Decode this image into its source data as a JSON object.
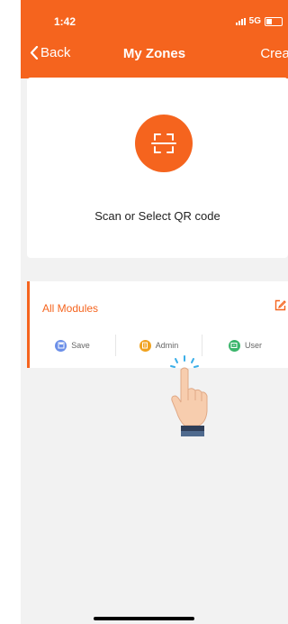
{
  "status_bar": {
    "time": "1:42",
    "network": "5G"
  },
  "nav": {
    "back_label": "Back",
    "title": "My Zones",
    "create_label": "Creat"
  },
  "scan": {
    "label": "Scan or Select QR code"
  },
  "modules": {
    "title": "All Modules",
    "actions": [
      {
        "label": "Save",
        "icon": "save-icon",
        "color": "#6b8fe8"
      },
      {
        "label": "Admin",
        "icon": "admin-icon",
        "color": "#f0a21e"
      },
      {
        "label": "User",
        "icon": "user-icon",
        "color": "#3bb56b"
      }
    ]
  },
  "colors": {
    "accent": "#f5641e"
  }
}
